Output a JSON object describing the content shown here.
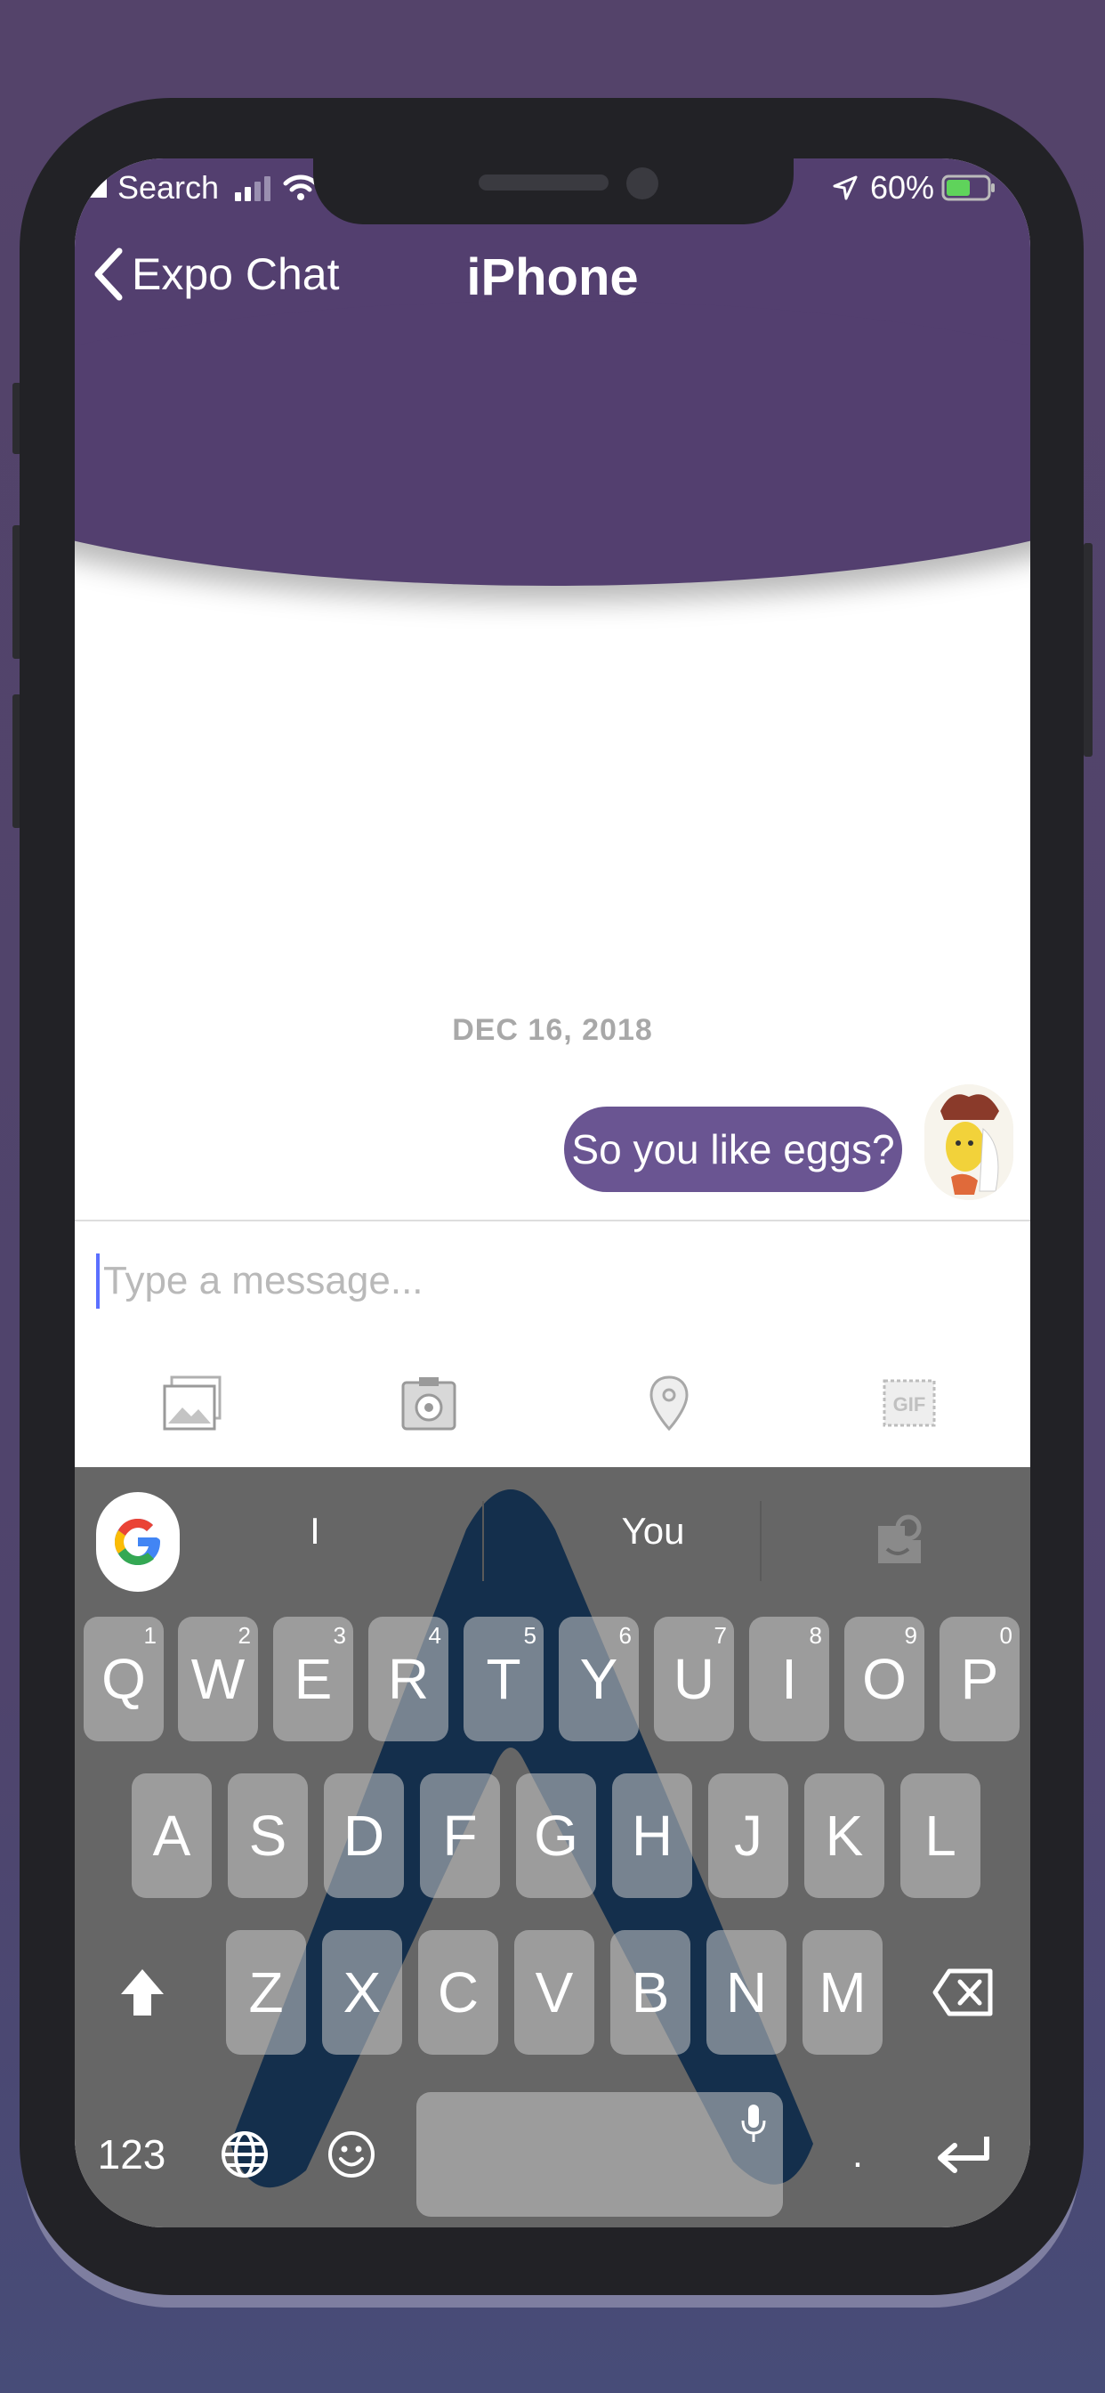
{
  "status_bar": {
    "back_app": "Search",
    "battery": "60%"
  },
  "nav": {
    "back_label": "Expo Chat",
    "title": "iPhone"
  },
  "chat": {
    "date": "DEC 16, 2018",
    "messages": [
      {
        "text": "So you like eggs?",
        "side": "right"
      }
    ]
  },
  "composer": {
    "placeholder": "Type a message..."
  },
  "toolbar": {
    "icons": [
      "photo-library-icon",
      "camera-icon",
      "location-pin-icon",
      "gif-icon"
    ]
  },
  "keyboard": {
    "suggestions": [
      "I",
      "You"
    ],
    "row1": [
      {
        "label": "Q",
        "hint": "1"
      },
      {
        "label": "W",
        "hint": "2"
      },
      {
        "label": "E",
        "hint": "3"
      },
      {
        "label": "R",
        "hint": "4"
      },
      {
        "label": "T",
        "hint": "5"
      },
      {
        "label": "Y",
        "hint": "6"
      },
      {
        "label": "U",
        "hint": "7"
      },
      {
        "label": "I",
        "hint": "8"
      },
      {
        "label": "O",
        "hint": "9"
      },
      {
        "label": "P",
        "hint": "0"
      }
    ],
    "row2": [
      "A",
      "S",
      "D",
      "F",
      "G",
      "H",
      "J",
      "K",
      "L"
    ],
    "row3": [
      "Z",
      "X",
      "C",
      "V",
      "B",
      "N",
      "M"
    ],
    "numbers_label": "123",
    "period_label": "."
  },
  "colors": {
    "brand": "#533f6f",
    "bubble": "#6a5592",
    "keyboard_bg": "#666666"
  }
}
